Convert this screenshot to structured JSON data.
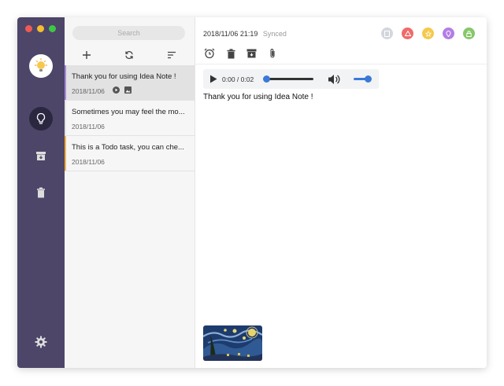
{
  "search": {
    "placeholder": "Search"
  },
  "notes": [
    {
      "title": "Thank you for using Idea Note !",
      "date": "2018/11/06",
      "accent": "#a58bd6",
      "has_audio": true,
      "has_image": true
    },
    {
      "title": "Sometimes you may feel the mo...",
      "date": "2018/11/06",
      "accent": "#e3e3e3"
    },
    {
      "title": "This is a Todo task, you can che...",
      "date": "2018/11/06",
      "accent": "#f2b24a"
    }
  ],
  "editor": {
    "timestamp": "2018/11/06 21:19",
    "status": "Synced",
    "body": "Thank you for using Idea Note !",
    "audio": {
      "time": "0:00 / 0:02",
      "progress": 0,
      "volume": 1.0
    },
    "color_dots": [
      "#d3d6dc",
      "#f06a6a",
      "#f5c94c",
      "#b37ee6",
      "#86c76a"
    ]
  },
  "icons": {
    "sidebar": [
      "lightbulb-icon",
      "archive-icon",
      "trash-icon",
      "settings-icon"
    ],
    "notes_toolbar": [
      "add-icon",
      "sync-icon",
      "sort-icon"
    ],
    "editor_toolbar": [
      "alarm-icon",
      "trash-icon",
      "archive-icon",
      "attachment-icon"
    ]
  }
}
